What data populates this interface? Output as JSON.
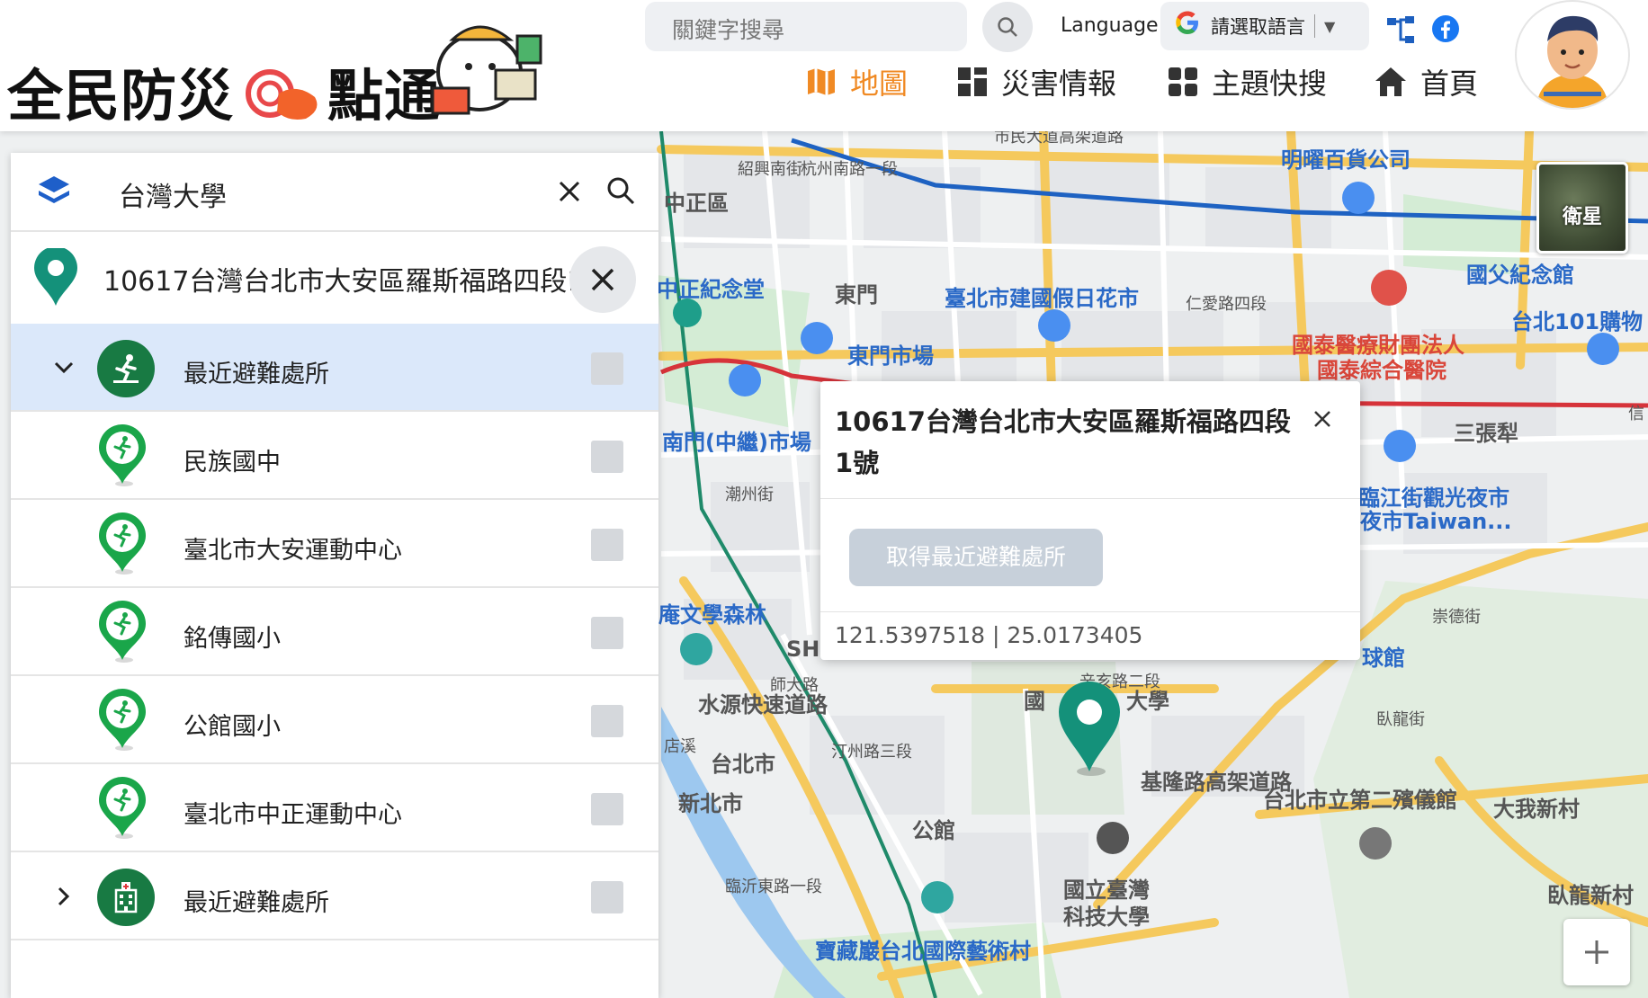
{
  "header": {
    "logo_text_1": "全民防災",
    "logo_text_2": "點通",
    "search_placeholder": "關鍵字搜尋",
    "language_label": "Language",
    "language_select": "請選取語言",
    "nav": [
      {
        "label": "地圖",
        "icon": "map-icon",
        "color": "#f08a24"
      },
      {
        "label": "災害情報",
        "icon": "grid-icon"
      },
      {
        "label": "主題快搜",
        "icon": "apps-icon"
      },
      {
        "label": "首頁",
        "icon": "home-icon"
      }
    ]
  },
  "sidebar": {
    "query": "台灣大學",
    "address": "10617台灣台北市大安區羅斯福路四段1號",
    "items": [
      {
        "label": "最近避難處所",
        "type": "group",
        "expanded": true,
        "icon": "evacuation-icon"
      },
      {
        "label": "民族國中",
        "type": "item",
        "icon": "evacuation-pin-icon"
      },
      {
        "label": "臺北市大安運動中心",
        "type": "item",
        "icon": "evacuation-pin-icon"
      },
      {
        "label": "銘傳國小",
        "type": "item",
        "icon": "evacuation-pin-icon"
      },
      {
        "label": "公館國小",
        "type": "item",
        "icon": "evacuation-pin-icon"
      },
      {
        "label": "臺北市中正運動中心",
        "type": "item",
        "icon": "evacuation-pin-icon"
      },
      {
        "label": "最近避難處所",
        "type": "group",
        "expanded": false,
        "icon": "hospital-icon"
      }
    ]
  },
  "popup": {
    "title": "10617台灣台北市大安區羅斯福路四段1號",
    "button": "取得最近避難處所",
    "coords": "121.5397518 | 25.0173405"
  },
  "map": {
    "satellite_label": "衛星",
    "labels": [
      {
        "text": "市民大道高架道路",
        "cls": "ml-dark ml-small"
      },
      {
        "text": "明曜百貨公司",
        "cls": "ml-blue"
      },
      {
        "text": "中正區",
        "cls": "ml-dark"
      },
      {
        "text": "中正紀念堂",
        "cls": "ml-blue"
      },
      {
        "text": "東門",
        "cls": "ml-dark"
      },
      {
        "text": "臺北市建國假日花市",
        "cls": "ml-blue"
      },
      {
        "text": "仁愛路四段",
        "cls": "ml-small"
      },
      {
        "text": "國父紀念館",
        "cls": "ml-blue"
      },
      {
        "text": "台北101購物",
        "cls": "ml-blue"
      },
      {
        "text": "東門市場",
        "cls": "ml-blue"
      },
      {
        "text": "國泰醫療財團法人",
        "cls": "ml-red"
      },
      {
        "text": "國泰綜合醫院",
        "cls": "ml-red"
      },
      {
        "text": "南門(中繼)市場",
        "cls": "ml-blue"
      },
      {
        "text": "三張犁",
        "cls": "ml-dark"
      },
      {
        "text": "潮州街",
        "cls": "ml-small"
      },
      {
        "text": "臨江街觀光夜市",
        "cls": "ml-blue"
      },
      {
        "text": "夜市Taiwan...",
        "cls": "ml-blue"
      },
      {
        "text": "庵文學森林",
        "cls": "ml-blue"
      },
      {
        "text": "SH",
        "cls": "ml-dark"
      },
      {
        "text": "球館",
        "cls": "ml-blue"
      },
      {
        "text": "崇德街",
        "cls": "ml-small"
      },
      {
        "text": "師大路",
        "cls": "ml-small"
      },
      {
        "text": "大學",
        "cls": "ml-dark"
      },
      {
        "text": "國",
        "cls": "ml-dark"
      },
      {
        "text": "辛亥路二段",
        "cls": "ml-small"
      },
      {
        "text": "臥龍街",
        "cls": "ml-small"
      },
      {
        "text": "水源快速道路",
        "cls": "ml-dark"
      },
      {
        "text": "汀州路三段",
        "cls": "ml-small"
      },
      {
        "text": "基隆路高架道路",
        "cls": "ml-dark"
      },
      {
        "text": "台北市立第二殯儀館",
        "cls": "ml-dark"
      },
      {
        "text": "大我新村",
        "cls": "ml-dark"
      },
      {
        "text": "公館",
        "cls": "ml-dark"
      },
      {
        "text": "國立臺灣",
        "cls": "ml-dark"
      },
      {
        "text": "科技大學",
        "cls": "ml-dark"
      },
      {
        "text": "臥龍新村",
        "cls": "ml-dark"
      },
      {
        "text": "新北市",
        "cls": "ml-dark"
      },
      {
        "text": "台北市",
        "cls": "ml-dark"
      },
      {
        "text": "寶藏巖台北國際藝術村",
        "cls": "ml-blue"
      },
      {
        "text": "杭州南路一段",
        "cls": "ml-small"
      },
      {
        "text": "紹興南街",
        "cls": "ml-small"
      },
      {
        "text": "信",
        "cls": "ml-small"
      },
      {
        "text": "店溪",
        "cls": "ml-small"
      },
      {
        "text": "臨沂東路一段",
        "cls": "ml-small"
      }
    ]
  }
}
